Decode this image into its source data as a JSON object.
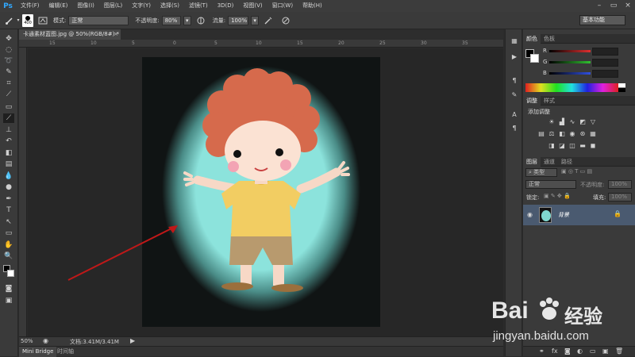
{
  "app": {
    "logo": "Ps"
  },
  "menu": [
    "文件(F)",
    "编辑(E)",
    "图像(I)",
    "图层(L)",
    "文字(Y)",
    "选择(S)",
    "滤镜(T)",
    "3D(D)",
    "视图(V)",
    "窗口(W)",
    "帮助(H)"
  ],
  "window_controls": [
    "–",
    "▭",
    "×"
  ],
  "options": {
    "brush_size": "400",
    "mode_label": "模式:",
    "mode_value": "正常",
    "opacity_label": "不透明度:",
    "opacity_value": "80%",
    "flow_label": "流量:",
    "flow_value": "100%",
    "workspace": "基本功能"
  },
  "document": {
    "tab_title": "卡通素材蓝图.jpg @ 50%(RGB/8#) *",
    "close": "×",
    "zoom": "50%",
    "doc_info": "文档:3.41M/3.41M"
  },
  "ruler": {
    "h_marks": [
      "15",
      "10",
      "5",
      "0",
      "5",
      "10",
      "15",
      "20",
      "25",
      "30",
      "35"
    ]
  },
  "bottom_tabs": {
    "mini_bridge": "Mini Bridge",
    "timeline": "时间轴"
  },
  "panels": {
    "color_tabs": [
      "颜色",
      "色板"
    ],
    "channels": [
      {
        "label": "R",
        "color": "#e03030"
      },
      {
        "label": "G",
        "color": "#30c030"
      },
      {
        "label": "B",
        "color": "#3050e0"
      }
    ],
    "adjust_tabs": [
      "调整",
      "样式"
    ],
    "adjust_title": "添加调整",
    "layers_tabs": [
      "图层",
      "通道",
      "路径"
    ],
    "filter_kind": "类型",
    "blend_mode": "正常",
    "opacity_label": "不透明度:",
    "opacity_value": "100%",
    "lock_label": "锁定:",
    "fill_label": "填充:",
    "fill_value": "100%",
    "layer_name": "背景"
  },
  "watermark": {
    "brand": "Bai",
    "brand2": "经验",
    "url": "jingyan.baidu.com"
  }
}
